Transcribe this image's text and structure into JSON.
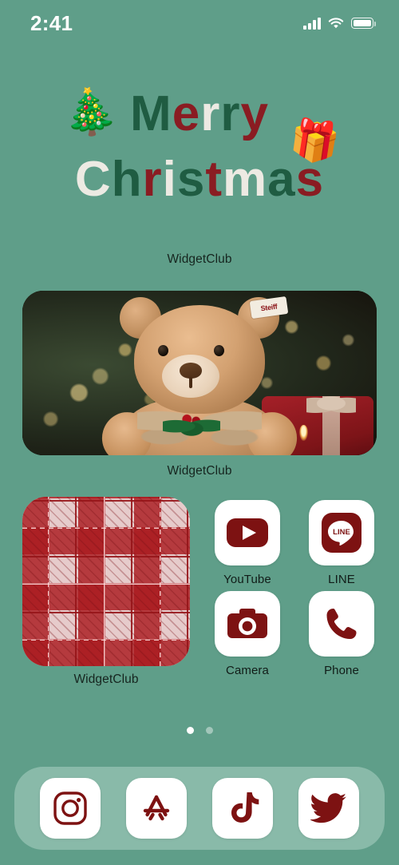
{
  "status_bar": {
    "time": "2:41",
    "signal_icon": "cellular-signal-icon",
    "wifi_icon": "wifi-icon",
    "battery_icon": "battery-icon"
  },
  "wallpaper": {
    "background_color": "#5f9e89"
  },
  "title": {
    "line1": "Merry",
    "line2": "Christmas",
    "line1_letters": [
      {
        "char": "M",
        "color": "#1f5c42"
      },
      {
        "char": "e",
        "color": "#8a1c22"
      },
      {
        "char": "r",
        "color": "#edeae3"
      },
      {
        "char": "r",
        "color": "#1f5c42"
      },
      {
        "char": "y",
        "color": "#8a1c22"
      }
    ],
    "line2_letters": [
      {
        "char": "C",
        "color": "#edeae3"
      },
      {
        "char": "h",
        "color": "#1f5c42"
      },
      {
        "char": "r",
        "color": "#8a1c22"
      },
      {
        "char": "i",
        "color": "#edeae3"
      },
      {
        "char": "s",
        "color": "#1f5c42"
      },
      {
        "char": "t",
        "color": "#8a1c22"
      },
      {
        "char": "m",
        "color": "#edeae3"
      },
      {
        "char": "a",
        "color": "#1f5c42"
      },
      {
        "char": "s",
        "color": "#8a1c22"
      }
    ],
    "tree_emoji": "🎄",
    "gift_emoji": "🎁",
    "colors": {
      "green": "#1f5c42",
      "red": "#8a1c22",
      "white": "#edeae3"
    }
  },
  "widgets": {
    "text_widget_label": "WidgetClub",
    "photo_widget_label": "WidgetClub",
    "plaid_widget_label": "WidgetClub",
    "photo_widget_alt": "teddy-bear-christmas-photo",
    "photo_tag_text": "Steiff",
    "plaid_widget_alt": "red-gingham-plaid-pattern"
  },
  "apps": [
    {
      "name": "YouTube",
      "icon": "youtube-icon"
    },
    {
      "name": "LINE",
      "icon": "line-icon"
    },
    {
      "name": "Camera",
      "icon": "camera-icon"
    },
    {
      "name": "Phone",
      "icon": "phone-icon"
    }
  ],
  "page_indicator": {
    "total": 2,
    "active_index": 0
  },
  "dock": {
    "items": [
      {
        "name": "Instagram",
        "icon": "instagram-icon"
      },
      {
        "name": "App Store",
        "icon": "app-store-icon"
      },
      {
        "name": "TikTok",
        "icon": "tiktok-icon"
      },
      {
        "name": "Twitter",
        "icon": "twitter-icon"
      }
    ],
    "background_color": "rgba(214,235,226,.36)"
  },
  "accent_colors": {
    "icon_glyph": "#7d1212",
    "icon_background": "#ffffff"
  }
}
